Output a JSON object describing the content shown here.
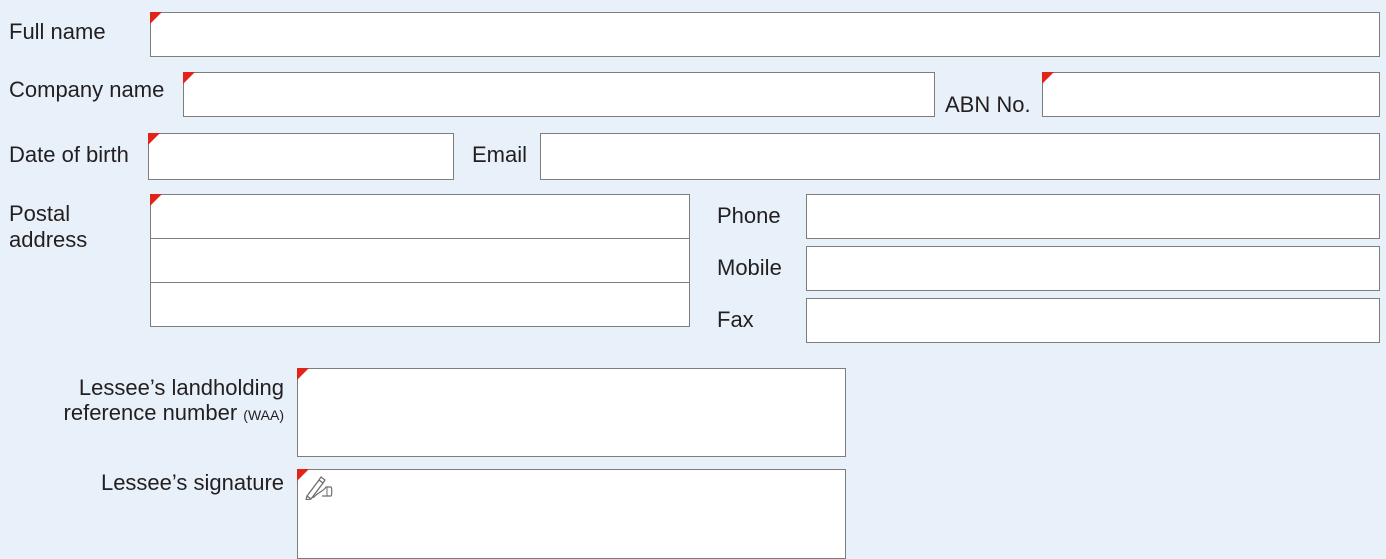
{
  "form": {
    "full_name": {
      "label": "Full name",
      "value": ""
    },
    "company_name": {
      "label": "Company name",
      "value": ""
    },
    "abn": {
      "label": "ABN No.",
      "value": ""
    },
    "date_of_birth": {
      "label": "Date of birth",
      "value": ""
    },
    "email": {
      "label": "Email",
      "value": ""
    },
    "postal_address": {
      "label_line1": "Postal",
      "label_line2": "address",
      "lines": [
        "",
        "",
        ""
      ]
    },
    "phone": {
      "label": "Phone",
      "value": ""
    },
    "mobile": {
      "label": "Mobile",
      "value": ""
    },
    "fax": {
      "label": "Fax",
      "value": ""
    },
    "landholding_ref": {
      "label_line1": "Lessee’s landholding",
      "label_line2": "reference number",
      "label_suffix": "(WAA)",
      "value": ""
    },
    "signature": {
      "label": "Lessee’s signature",
      "icon": "signature-pen-icon"
    }
  },
  "colors": {
    "background": "#e8f1fa",
    "field_border": "#7d7d7d",
    "required_marker": "#e2231a",
    "text": "#231f20"
  }
}
